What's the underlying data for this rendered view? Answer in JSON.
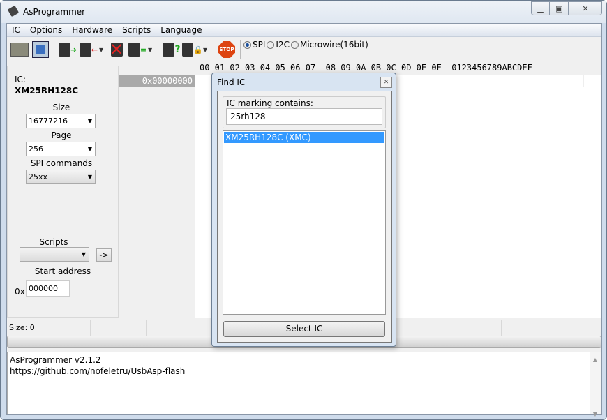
{
  "window": {
    "title": "AsProgrammer"
  },
  "menu": [
    "IC",
    "Options",
    "Hardware",
    "Scripts",
    "Language"
  ],
  "toolbar": {
    "protocols": [
      {
        "label": "SPI",
        "selected": true
      },
      {
        "label": "I2C",
        "selected": false
      },
      {
        "label": "Microwire(16bit)",
        "selected": false
      }
    ],
    "stop_label": "STOP"
  },
  "hex": {
    "header": "00 01 02 03 04 05 06 07  08 09 0A 0B 0C 0D 0E 0F  0123456789ABCDEF",
    "address": "0x00000000"
  },
  "left": {
    "ic_label": "IC:",
    "ic_name": "XM25RH128C",
    "size_label": "Size",
    "size_value": "16777216",
    "page_label": "Page",
    "page_value": "256",
    "spi_label": "SPI commands",
    "spi_value": "25xx",
    "scripts_label": "Scripts",
    "scripts_value": "",
    "go_label": "->",
    "start_label": "Start address",
    "start_prefix": "0x",
    "start_value": "000000"
  },
  "status": {
    "size": "Size: 0"
  },
  "log": [
    "AsProgrammer v2.1.2",
    "https://github.com/nofeletru/UsbAsp-flash"
  ],
  "dialog": {
    "title": "Find IC",
    "group_label": "IC marking contains:",
    "search_value": "25rh128",
    "results": [
      "XM25RH128C (XMC)"
    ],
    "select_label": "Select IC"
  }
}
